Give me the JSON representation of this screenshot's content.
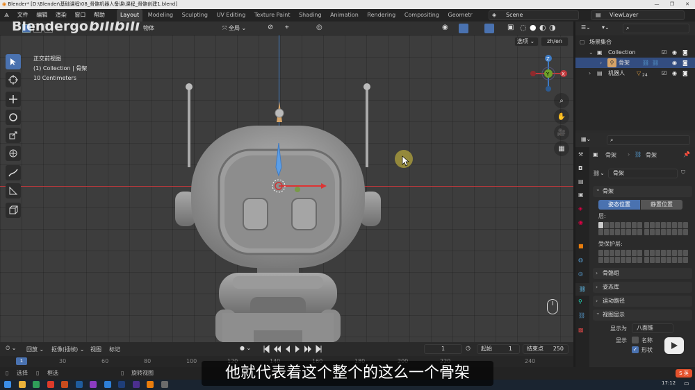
{
  "window": {
    "title": "Blender* [D:\\Blender\\基础课程\\08_骨骼机器人备课\\课程_骨骼创建1.blend]",
    "min": "—",
    "max": "❐",
    "close": "✕"
  },
  "watermark": {
    "channel": "Blendergo",
    "site": "bilibili"
  },
  "menu": {
    "items": [
      "文件",
      "编辑",
      "渲染",
      "窗口",
      "帮助"
    ]
  },
  "workspaces": {
    "tabs": [
      "Layout",
      "Modeling",
      "Sculpting",
      "UV Editing",
      "Texture Paint",
      "Shading",
      "Animation",
      "Rendering",
      "Compositing",
      "Geometr"
    ],
    "active": "Layout"
  },
  "scene": {
    "name": "Scene",
    "viewlayer": "ViewLayer"
  },
  "viewport": {
    "header": {
      "object_menu": "物体",
      "transform": "全局",
      "options": "选项",
      "lang": "zh/en"
    },
    "info": {
      "view": "正交前视图",
      "collection": "(1) Collection | 骨架",
      "scale": "10 Centimeters"
    },
    "gizmo": {
      "z": "Z",
      "y": "Y",
      "x": "X"
    }
  },
  "timeline": {
    "playback": "回放",
    "keying": "抠像(插帧)",
    "view": "视图",
    "marker": "标记",
    "current_frame": "1",
    "start_label": "起始",
    "start": "1",
    "end_label": "结束点",
    "end": "250",
    "ruler": [
      "1",
      "30",
      "60",
      "80",
      "100",
      "120",
      "140",
      "160",
      "180",
      "200",
      "220",
      "240"
    ]
  },
  "outliner": {
    "root": "场景集合",
    "rows": [
      {
        "label": "Collection"
      },
      {
        "label": "骨架"
      },
      {
        "label": "机器人",
        "badge": "24"
      }
    ]
  },
  "properties": {
    "breadcrumb": [
      "骨架",
      "骨架"
    ],
    "data_name": "骨架",
    "panel_title": "骨架",
    "pose_position": "姿态位置",
    "rest_position": "静置位置",
    "layers_label": "层:",
    "protected_label": "受保护层:",
    "sections": [
      "骨骼组",
      "姿态库",
      "运动路径",
      "视图显示"
    ],
    "display_as_label": "显示为",
    "display_as": "八面锥",
    "show_label": "显示",
    "name_opt": "名称",
    "shape_opt": "形状"
  },
  "statusbar": {
    "select": "选择",
    "box_select": "框选",
    "rotate_view": "旋转视图",
    "ime": "英"
  },
  "taskbar": {
    "time": "17:12"
  },
  "subtitle": "他就代表着这个整个的这么一个骨架",
  "colors": {
    "accent": "#4a72b0",
    "axis_x": "#c0383c",
    "axis_y": "#6fa02a",
    "axis_z": "#3e7bc4",
    "active_row": "#334d80",
    "playhead": "#4a72b0"
  }
}
